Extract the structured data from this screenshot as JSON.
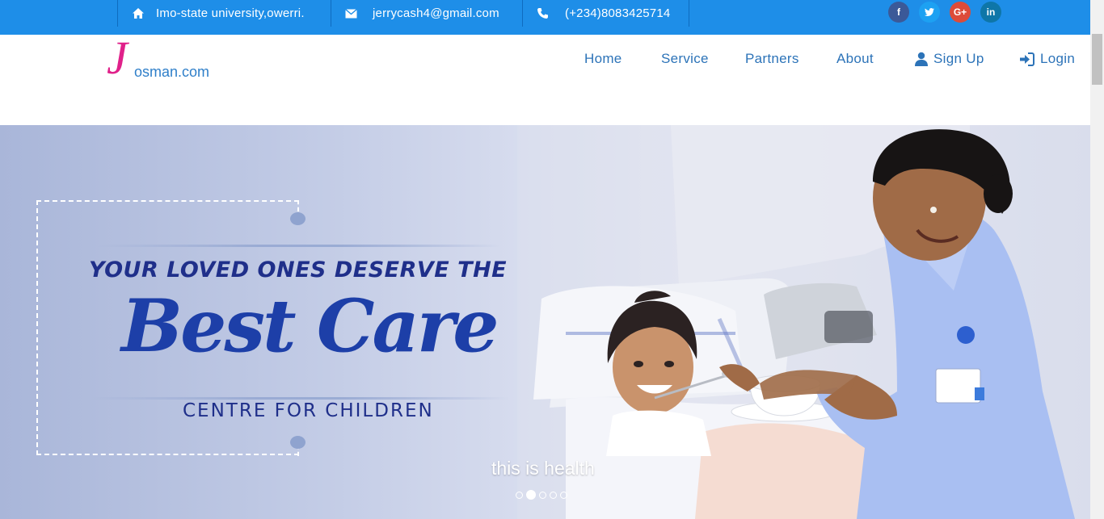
{
  "topbar": {
    "address": "Imo-state university,owerri.",
    "email": "jerrycash4@gmail.com",
    "phone": "(+234)8083425714",
    "social": [
      {
        "name": "facebook",
        "glyph": "f",
        "color": "#3b5998"
      },
      {
        "name": "twitter",
        "glyph": "t",
        "color": "#1da1f2"
      },
      {
        "name": "google-plus",
        "glyph": "G+",
        "color": "#dd4b39"
      },
      {
        "name": "linkedin",
        "glyph": "in",
        "color": "#0e76a8"
      }
    ]
  },
  "brand": {
    "initial": "J",
    "rest": "osman.com"
  },
  "nav": {
    "home": "Home",
    "service": "Service",
    "partners": "Partners",
    "about": "About",
    "signup": "Sign Up",
    "login": "Login"
  },
  "hero": {
    "line1": "YOUR LOVED ONES DESERVE THE",
    "line2": "Best Care",
    "line3": "CENTRE FOR CHILDREN",
    "caption": "this is health",
    "slides": 5,
    "active_slide": 2
  },
  "colors": {
    "topbar": "#1e8ee8",
    "nav_text": "#2c73b8",
    "brand_pink": "#e0218a",
    "hero_text": "#1f2f8a"
  }
}
